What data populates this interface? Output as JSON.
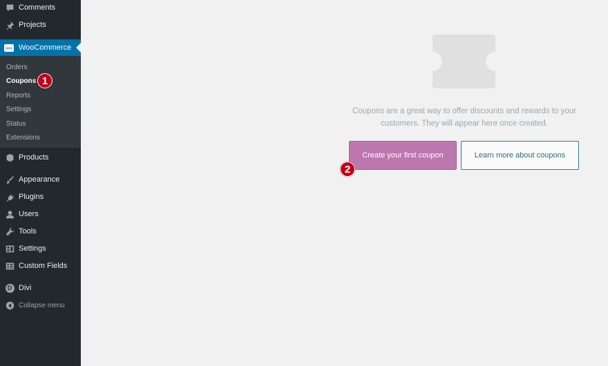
{
  "sidebar": {
    "items": {
      "comments": "Comments",
      "projects": "Projects",
      "woocommerce": "WooCommerce",
      "products": "Products",
      "appearance": "Appearance",
      "plugins": "Plugins",
      "users": "Users",
      "tools": "Tools",
      "settings": "Settings",
      "custom_fields": "Custom Fields",
      "divi": "Divi",
      "collapse": "Collapse menu"
    },
    "woo_logo": "WOO",
    "divi_letter": "D",
    "submenu": {
      "orders": "Orders",
      "coupons": "Coupons",
      "reports": "Reports",
      "settings": "Settings",
      "status": "Status",
      "extensions": "Extensions"
    },
    "active_color": "#0073aa",
    "background_color": "#23282d"
  },
  "annotations": {
    "step1": "1",
    "step2": "2",
    "color": "#c30016"
  },
  "main": {
    "empty_state_text": "Coupons are a great way to offer discounts and rewards to your customers. They will appear here once created.",
    "create_button": "Create your first coupon",
    "learn_button": "Learn more about coupons",
    "create_button_color": "#bb77ae",
    "empty_icon": "coupon-ticket-icon"
  }
}
